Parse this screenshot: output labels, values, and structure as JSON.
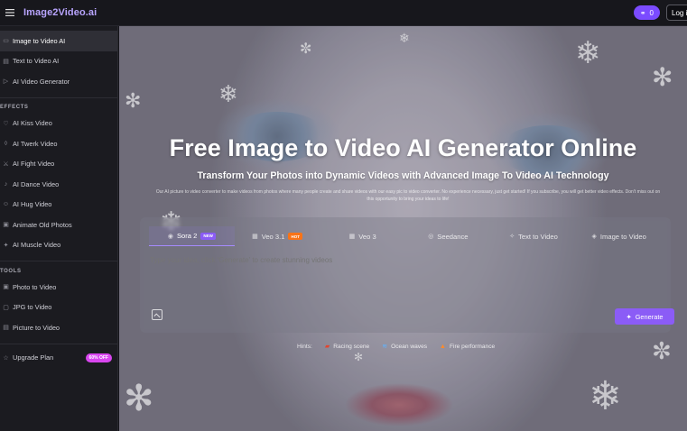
{
  "header": {
    "logo": "Image2Video.ai",
    "credits": "0",
    "login_label": "Log i"
  },
  "sidebar": {
    "main_items": [
      {
        "label": "Image to Video AI",
        "icon": "image-icon",
        "active": true
      },
      {
        "label": "Text to Video AI",
        "icon": "document-icon"
      },
      {
        "label": "AI Video Generator",
        "icon": "video-icon"
      }
    ],
    "effects_heading": "EFFECTS",
    "effects_items": [
      {
        "label": "AI Kiss Video",
        "icon": "kiss-icon"
      },
      {
        "label": "AI Twerk Video",
        "icon": "dance-icon"
      },
      {
        "label": "AI Fight Video",
        "icon": "fight-icon"
      },
      {
        "label": "AI Dance Video",
        "icon": "dancer-icon"
      },
      {
        "label": "AI Hug Video",
        "icon": "hug-icon"
      },
      {
        "label": "Animate Old Photos",
        "icon": "photo-icon"
      },
      {
        "label": "AI Muscle Video",
        "icon": "muscle-icon"
      }
    ],
    "tools_heading": "TOOLS",
    "tools_items": [
      {
        "label": "Photo to Video",
        "icon": "photo-icon"
      },
      {
        "label": "JPG to Video",
        "icon": "jpg-icon"
      },
      {
        "label": "Picture to Video",
        "icon": "picture-icon"
      }
    ],
    "upgrade": {
      "label": "Upgrade Plan",
      "badge": "60% OFF",
      "icon": "star-icon"
    }
  },
  "hero": {
    "title": "Free Image to Video AI Generator Online",
    "subtitle": "Transform Your Photos into Dynamic Videos with Advanced Image To Video AI Technology",
    "description": "Our AI picture to video converter to make videos from photos where many people create and share videos with our easy pic to video converter. No experience necessary, just get started! If you subscribe, you will get better video effects. Don't miss out on this opportunity to bring your ideas to life!"
  },
  "generator": {
    "tabs": [
      {
        "label": "Sora 2",
        "tag": "NEW",
        "icon": "sora-icon",
        "active": true
      },
      {
        "label": "Veo 3.1",
        "tag": "HOT",
        "icon": "veo-icon"
      },
      {
        "label": "Veo 3",
        "icon": "veo-icon"
      },
      {
        "label": "Seedance",
        "icon": "seedance-icon"
      },
      {
        "label": "Text to Video",
        "icon": "sparkle-icon"
      },
      {
        "label": "Image to Video",
        "icon": "cube-icon"
      }
    ],
    "placeholder": "Type your idea, click 'Generate' to create stunning videos",
    "generate_label": "Generate"
  },
  "hints": {
    "label": "Hints:",
    "chips": [
      {
        "label": "Racing scene",
        "icon": "car-icon"
      },
      {
        "label": "Ocean waves",
        "icon": "wave-icon"
      },
      {
        "label": "Fire performance",
        "icon": "fire-icon"
      }
    ]
  },
  "colors": {
    "accent": "#8b5cf6",
    "logo": "#b9a5ff",
    "hot": "#f97316",
    "badge": "#d946ef"
  }
}
